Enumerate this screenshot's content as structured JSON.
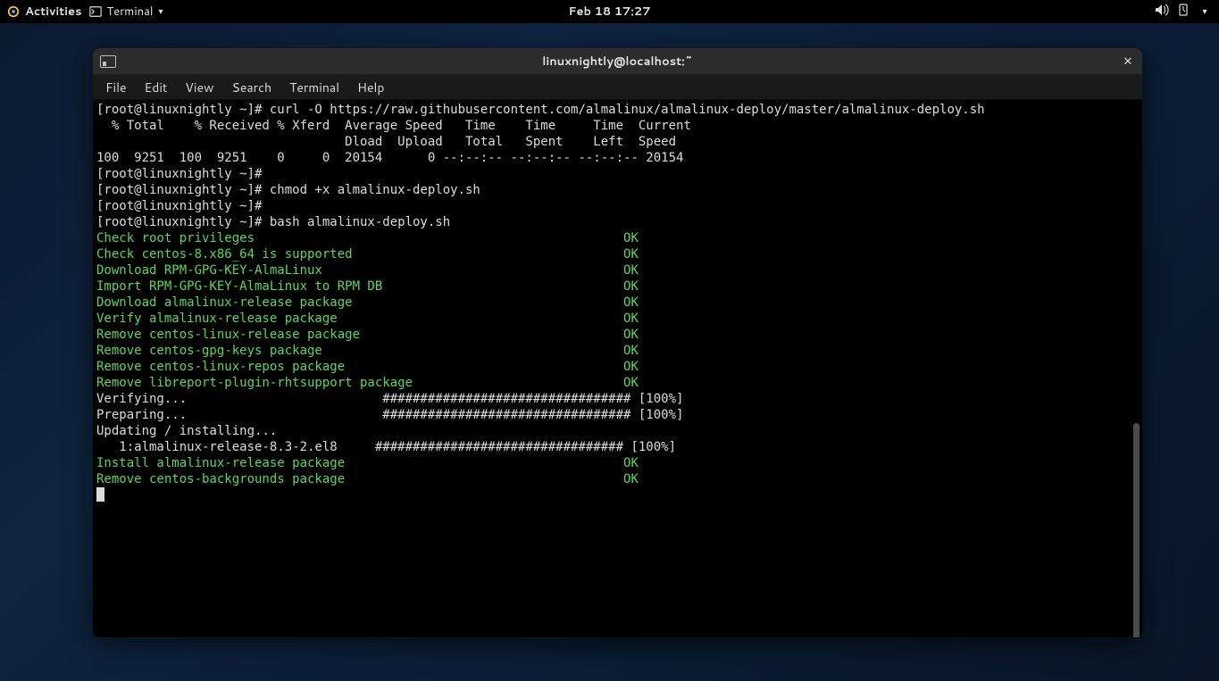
{
  "topbar": {
    "activities": "Activities",
    "app": "Terminal",
    "datetime": "Feb 18  17:27"
  },
  "window": {
    "title": "linuxnightly@localhost:~",
    "menu": [
      "File",
      "Edit",
      "View",
      "Search",
      "Terminal",
      "Help"
    ]
  },
  "term": {
    "prompt": "[root@linuxnightly ~]#",
    "cmd_curl": "curl -O https://raw.githubusercontent.com/almalinux/almalinux-deploy/master/almalinux-deploy.sh",
    "curl_hdr1": "  % Total    % Received % Xferd  Average Speed   Time    Time     Time  Current",
    "curl_hdr2": "                                 Dload  Upload   Total   Spent    Left  Speed",
    "curl_row": "100  9251  100  9251    0     0  20154      0 --:--:-- --:--:-- --:--:-- 20154",
    "cmd_chmod": "chmod +x almalinux-deploy.sh",
    "cmd_bash": "bash almalinux-deploy.sh",
    "steps": [
      "Check root privileges",
      "Check centos-8.x86_64 is supported",
      "Download RPM-GPG-KEY-AlmaLinux",
      "Import RPM-GPG-KEY-AlmaLinux to RPM DB",
      "Download almalinux-release package",
      "Verify almalinux-release package",
      "Remove centos-linux-release package",
      "Remove centos-gpg-keys package",
      "Remove centos-linux-repos package",
      "Remove libreport-plugin-rhtsupport package"
    ],
    "ok": "OK",
    "verify": "Verifying...                          ################################# [100%]",
    "prepare": "Preparing...                          ################################# [100%]",
    "updating": "Updating / installing...",
    "pkgline": "   1:almalinux-release-8.3-2.el8     ################################# [100%]",
    "steps2": [
      "Install almalinux-release package",
      "Remove centos-backgrounds package"
    ]
  }
}
